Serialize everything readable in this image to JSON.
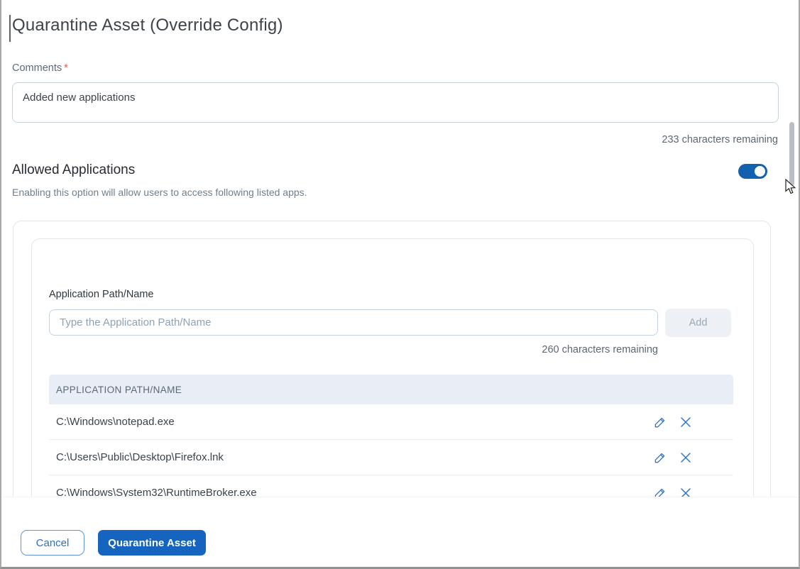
{
  "page": {
    "title": "Quarantine Asset (Override Config)"
  },
  "comments": {
    "label": "Comments",
    "required_marker": "*",
    "value": "Added new applications",
    "remaining": "233 characters remaining"
  },
  "allowed_apps": {
    "heading": "Allowed Applications",
    "description": "Enabling this option will allow users to access following listed apps.",
    "toggle_state": "on",
    "input_label": "Application Path/Name",
    "input_placeholder": "Type the Application Path/Name",
    "add_label": "Add",
    "remaining": "260 characters remaining",
    "table": {
      "header": "APPLICATION PATH/NAME",
      "rows": [
        "C:\\Windows\\notepad.exe",
        "C:\\Users\\Public\\Desktop\\Firefox.lnk",
        "C:\\Windows\\System32\\RuntimeBroker.exe"
      ]
    }
  },
  "footer": {
    "cancel_label": "Cancel",
    "submit_label": "Quarantine Asset"
  },
  "colors": {
    "primary_blue": "#1565c0",
    "toggle_blue": "#1260ae",
    "icon_blue": "#2e74c9",
    "required_red": "#e8594a",
    "table_header_bg": "#e9eef6"
  }
}
